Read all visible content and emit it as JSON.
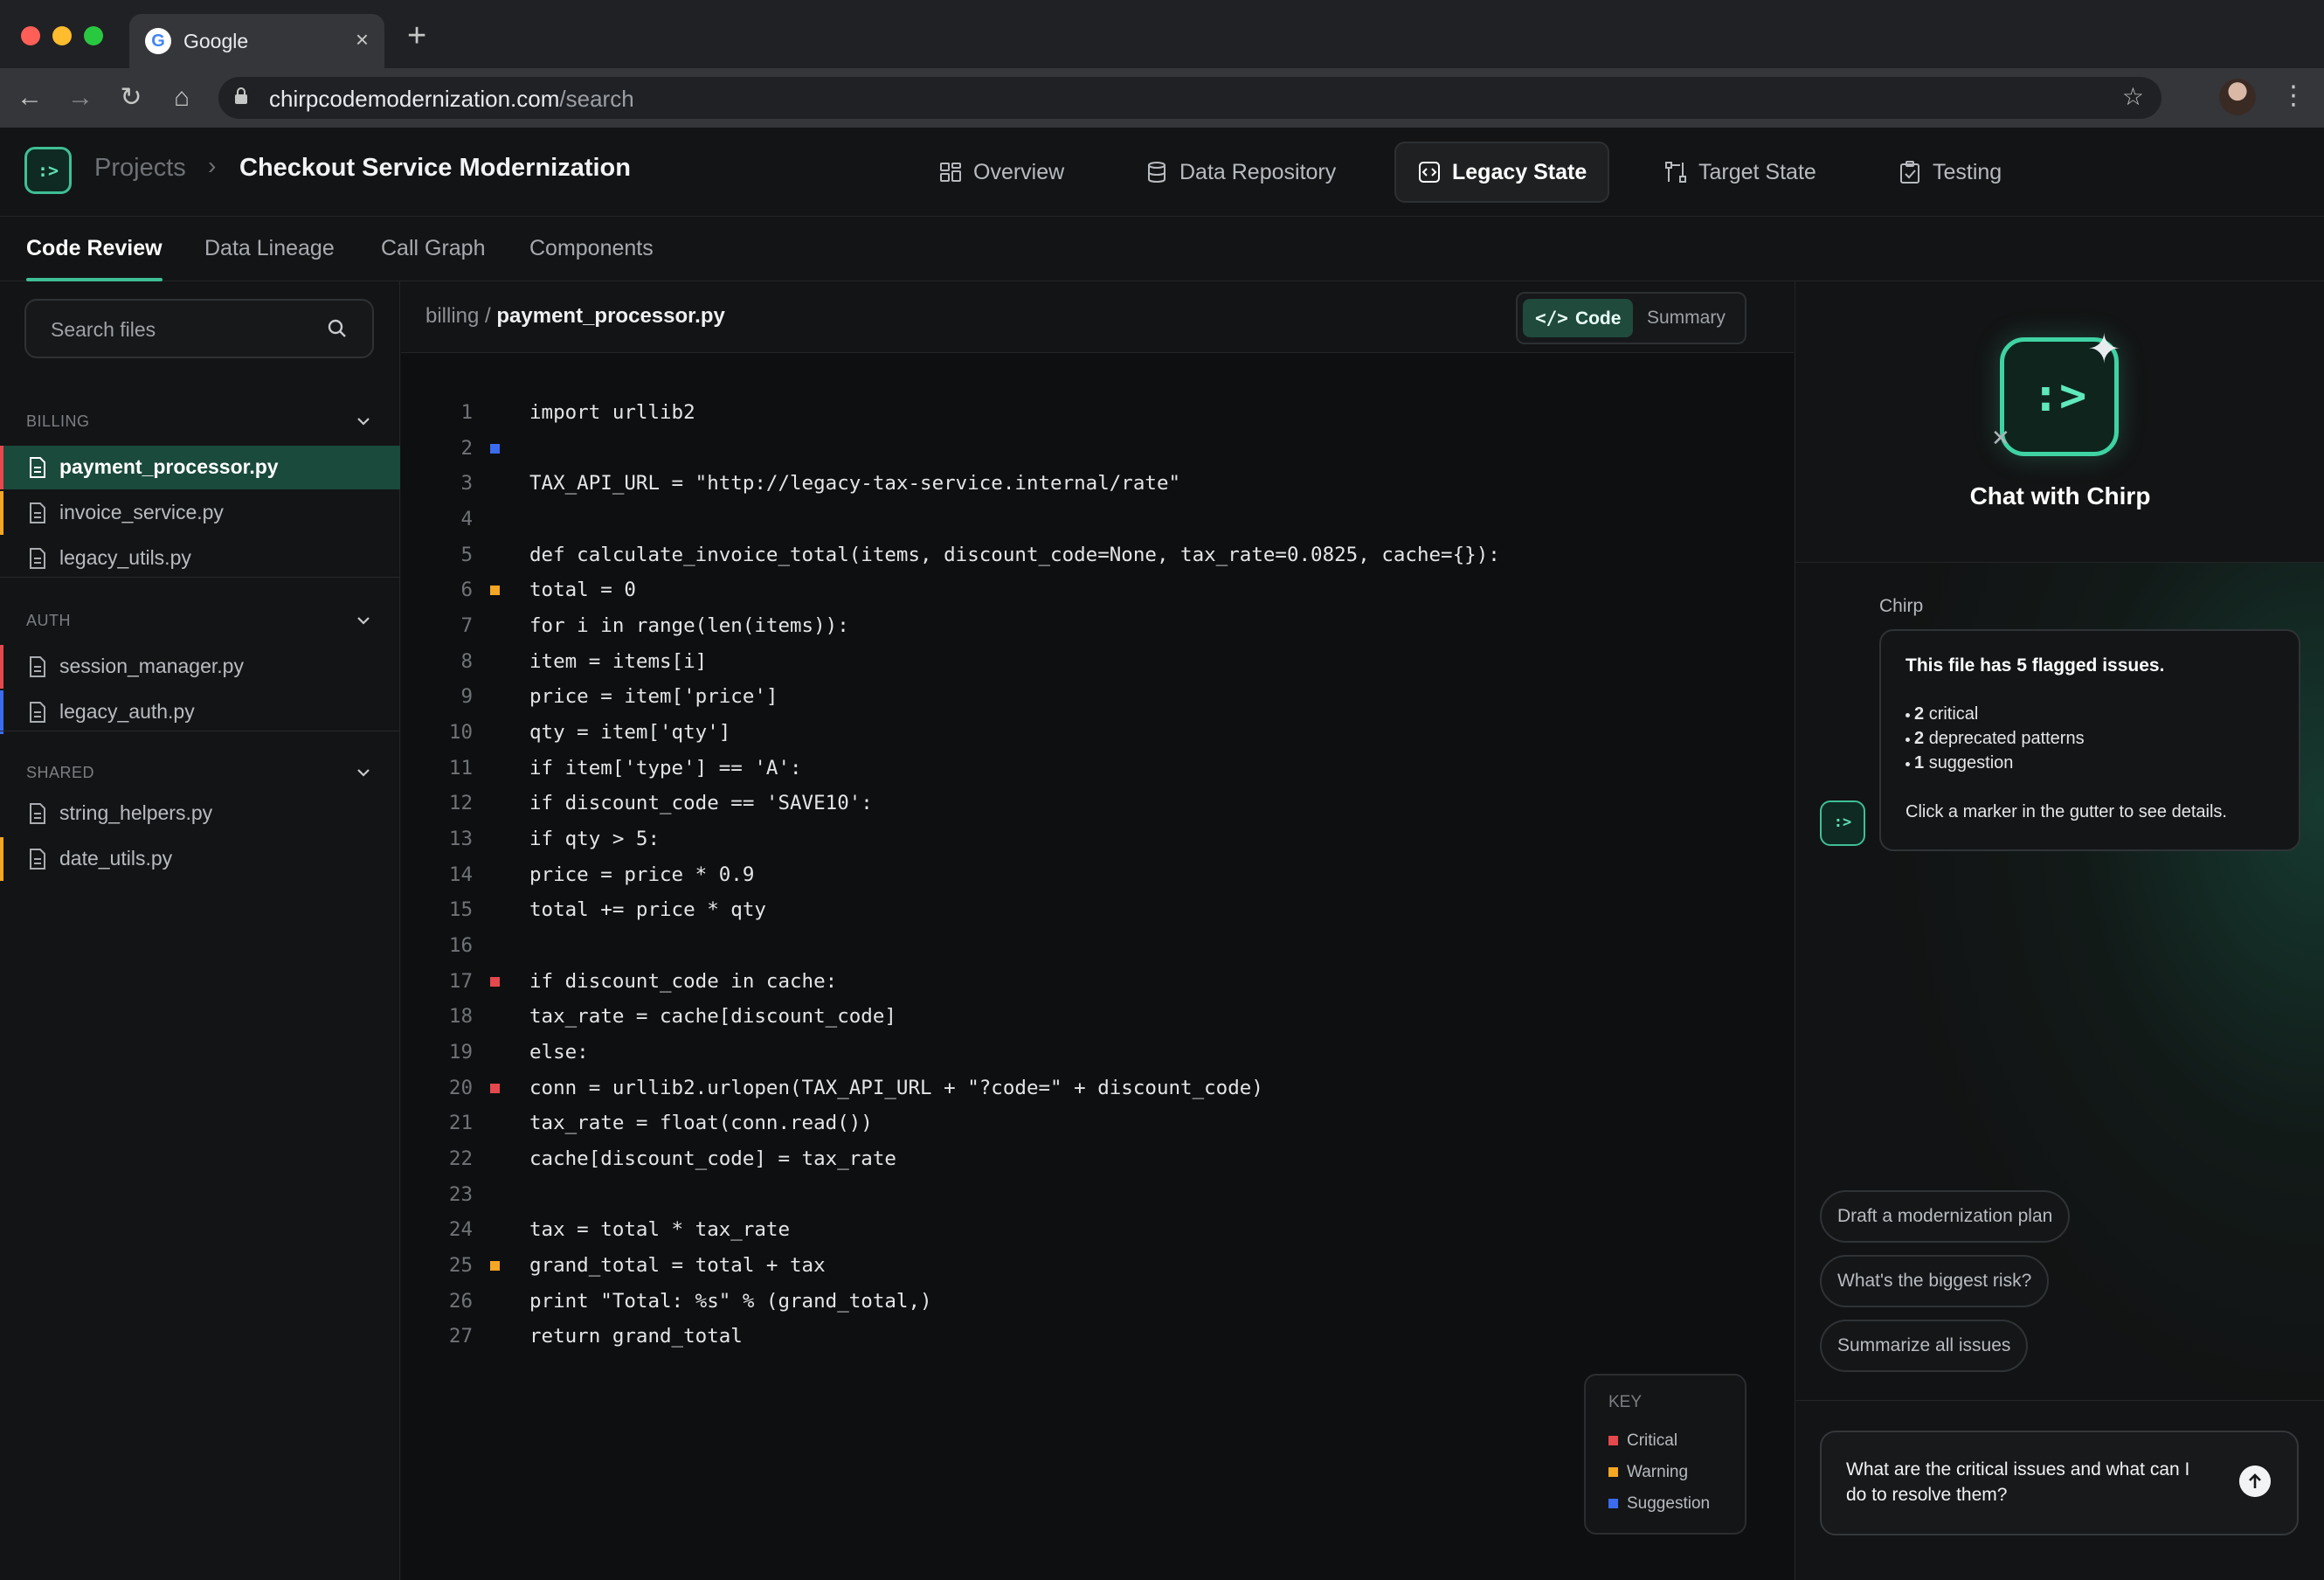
{
  "browser": {
    "tab_title": "Google",
    "url_domain": "chirpcodemodernization.com",
    "url_path": "/search"
  },
  "header": {
    "breadcrumb_root": "Projects",
    "breadcrumb_current": "Checkout Service Modernization",
    "nav": [
      {
        "label": "Overview",
        "icon": "overview-grid-icon"
      },
      {
        "label": "Data Repository",
        "icon": "database-icon"
      },
      {
        "label": "Legacy State",
        "icon": "code-window-icon",
        "active": true
      },
      {
        "label": "Target State",
        "icon": "target-flow-icon"
      },
      {
        "label": "Testing",
        "icon": "clipboard-check-icon"
      }
    ]
  },
  "subtabs": [
    "Code Review",
    "Data Lineage",
    "Call Graph",
    "Components"
  ],
  "sidebar": {
    "search_placeholder": "Search files",
    "groups": [
      {
        "title": "BILLING",
        "files": [
          {
            "name": "payment_processor.py",
            "selected": true,
            "flag": "#e5484d"
          },
          {
            "name": "invoice_service.py",
            "flag": "#f5a623"
          },
          {
            "name": "legacy_utils.py"
          }
        ]
      },
      {
        "title": "AUTH",
        "files": [
          {
            "name": "session_manager.py",
            "flag": "#e5484d"
          },
          {
            "name": "legacy_auth.py",
            "flag": "#3b6cf0"
          }
        ]
      },
      {
        "title": "SHARED",
        "files": [
          {
            "name": "string_helpers.py"
          },
          {
            "name": "date_utils.py",
            "flag": "#f5a623"
          }
        ]
      }
    ]
  },
  "editor": {
    "path_prefix": "billing /",
    "file_name": "payment_processor.py",
    "view_code": "Code",
    "view_summary": "Summary",
    "lines": [
      {
        "n": "1",
        "text": "import urllib2"
      },
      {
        "n": "2",
        "text": "",
        "marker": "suggestion"
      },
      {
        "n": "3",
        "text": "TAX_API_URL = \"http://legacy-tax-service.internal/rate\""
      },
      {
        "n": "4",
        "text": ""
      },
      {
        "n": "5",
        "text": "def calculate_invoice_total(items, discount_code=None, tax_rate=0.0825, cache={}):"
      },
      {
        "n": "6",
        "text": "total = 0",
        "marker": "warning"
      },
      {
        "n": "7",
        "text": "for i in range(len(items)):"
      },
      {
        "n": "8",
        "text": "item = items[i]"
      },
      {
        "n": "9",
        "text": "price = item['price']"
      },
      {
        "n": "10",
        "text": "qty = item['qty']"
      },
      {
        "n": "11",
        "text": "if item['type'] == 'A':"
      },
      {
        "n": "12",
        "text": "if discount_code == 'SAVE10':"
      },
      {
        "n": "13",
        "text": "if qty > 5:"
      },
      {
        "n": "14",
        "text": "price = price * 0.9"
      },
      {
        "n": "15",
        "text": "total += price * qty"
      },
      {
        "n": "16",
        "text": ""
      },
      {
        "n": "17",
        "text": "if discount_code in cache:",
        "marker": "critical"
      },
      {
        "n": "18",
        "text": "tax_rate = cache[discount_code]"
      },
      {
        "n": "19",
        "text": "else:"
      },
      {
        "n": "20",
        "text": "conn = urllib2.urlopen(TAX_API_URL + \"?code=\" + discount_code)",
        "marker": "critical"
      },
      {
        "n": "21",
        "text": "tax_rate = float(conn.read())"
      },
      {
        "n": "22",
        "text": "cache[discount_code] = tax_rate"
      },
      {
        "n": "23",
        "text": ""
      },
      {
        "n": "24",
        "text": "tax = total * tax_rate"
      },
      {
        "n": "25",
        "text": "grand_total = total + tax",
        "marker": "warning"
      },
      {
        "n": "26",
        "text": "print \"Total: %s\" % (grand_total,)"
      },
      {
        "n": "27",
        "text": "return grand_total"
      }
    ],
    "key": {
      "title": "KEY",
      "items": [
        {
          "label": "Critical",
          "color": "#e5484d"
        },
        {
          "label": "Warning",
          "color": "#f5a623"
        },
        {
          "label": "Suggestion",
          "color": "#3b6cf0"
        }
      ]
    },
    "marker_colors": {
      "critical": "#e5484d",
      "warning": "#f5a623",
      "suggestion": "#3b6cf0"
    }
  },
  "chat": {
    "title": "Chat with Chirp",
    "sender": "Chirp",
    "message_title": "This file has 5 flagged issues.",
    "bullets": [
      {
        "count": "2",
        "label": "critical"
      },
      {
        "count": "2",
        "label": "deprecated patterns"
      },
      {
        "count": "1",
        "label": "suggestion"
      }
    ],
    "message_footer": "Click a marker in the gutter to see details.",
    "chips": [
      "Draft a modernization plan",
      "What's the biggest risk?",
      "Summarize all issues"
    ],
    "input_text": "What are the critical issues and what can I do to resolve them?"
  },
  "logo_glyph": ":>",
  "accent": "#3fbf95"
}
